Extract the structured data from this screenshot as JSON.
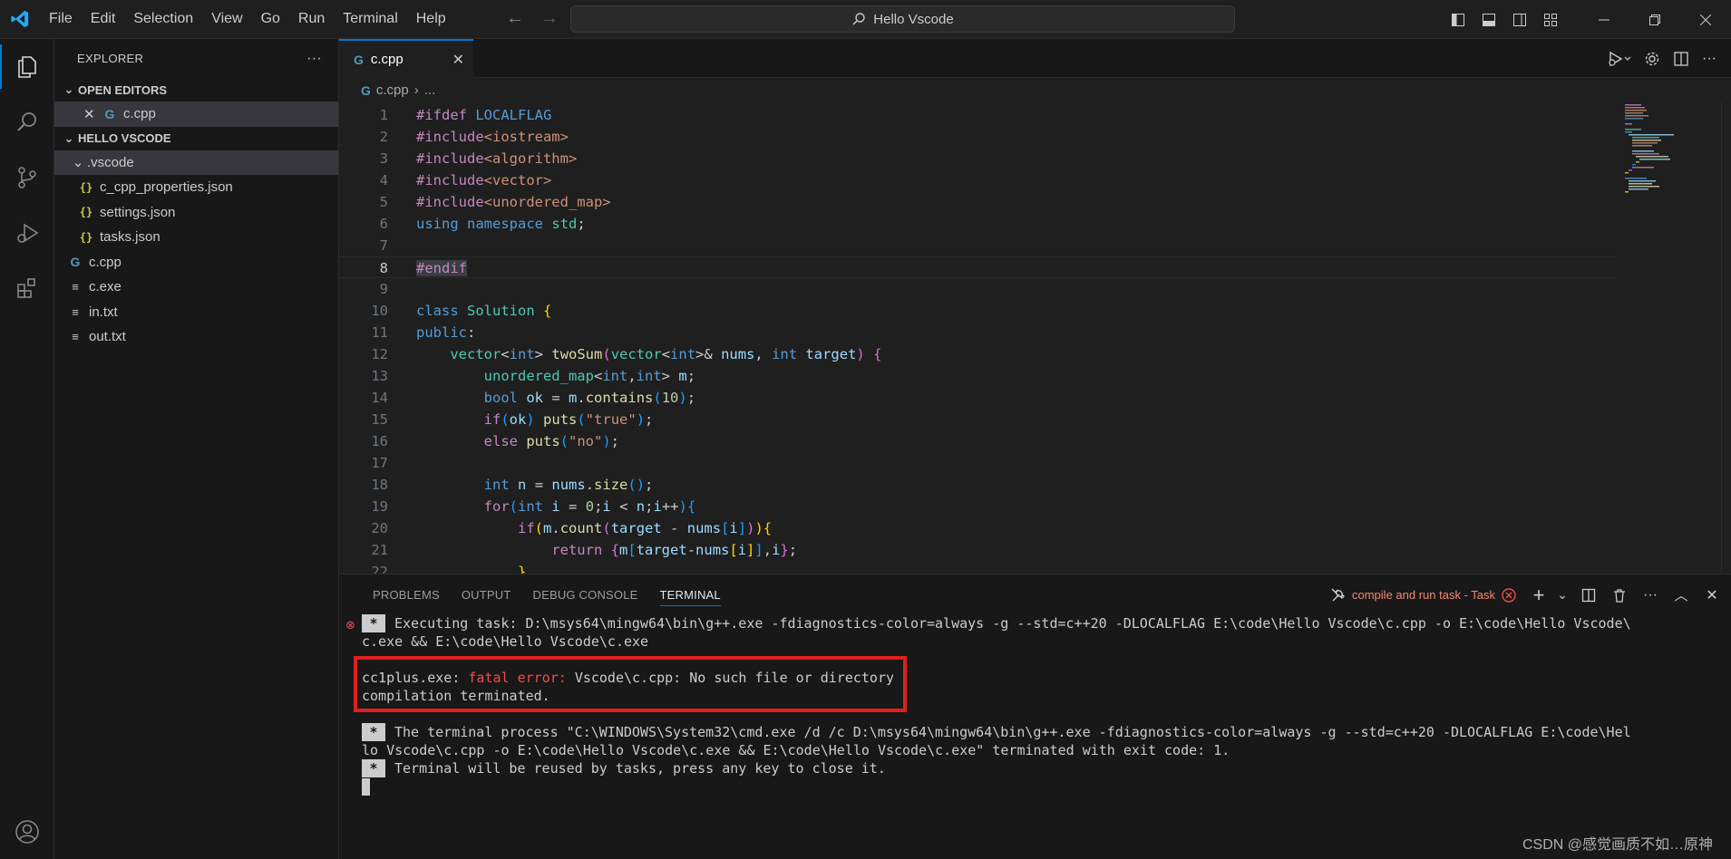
{
  "window": {
    "title": "Hello Vscode"
  },
  "menu": [
    "File",
    "Edit",
    "Selection",
    "View",
    "Go",
    "Run",
    "Terminal",
    "Help"
  ],
  "explorer": {
    "header": "EXPLORER",
    "more": "···",
    "open_editors_label": "OPEN EDITORS",
    "open_editor_file": "c.cpp",
    "project_label": "HELLO VSCODE",
    "folder": ".vscode",
    "folder_files": [
      "c_cpp_properties.json",
      "settings.json",
      "tasks.json"
    ],
    "root_files": [
      "c.cpp",
      "c.exe",
      "in.txt",
      "out.txt"
    ]
  },
  "editor": {
    "tab_label": "c.cpp",
    "breadcrumb_file": "c.cpp",
    "breadcrumb_rest": "...",
    "active_line": 8
  },
  "panel": {
    "tabs": [
      "PROBLEMS",
      "OUTPUT",
      "DEBUG CONSOLE",
      "TERMINAL"
    ],
    "active_tab": "TERMINAL",
    "task_label": "compile and run task - Task",
    "lines": {
      "l1": "Executing task: D:\\msys64\\mingw64\\bin\\g++.exe -fdiagnostics-color=always -g --std=c++20 -DLOCALFLAG E:\\code\\Hello Vscode\\c.cpp -o E:\\code\\Hello Vscode\\",
      "l2": "c.exe && E:\\code\\Hello Vscode\\c.exe",
      "l3a": "cc1plus.exe: ",
      "l3b": "fatal error: ",
      "l3c": "Vscode\\c.cpp: No such file or directory",
      "l4": "compilation terminated.",
      "l5": "The terminal process \"C:\\WINDOWS\\System32\\cmd.exe /d /c D:\\msys64\\mingw64\\bin\\g++.exe -fdiagnostics-color=always -g --std=c++20 -DLOCALFLAG E:\\code\\Hel",
      "l6": "lo Vscode\\c.cpp -o E:\\code\\Hello Vscode\\c.exe && E:\\code\\Hello Vscode\\c.exe\" terminated with exit code: 1.",
      "l7": "Terminal will be reused by tasks, press any key to close it."
    }
  },
  "watermark": "CSDN @感觉画质不如…原神",
  "colors": {
    "accent": "#0078d4",
    "error": "#f14c4c",
    "highlight_box": "#e0201c"
  }
}
